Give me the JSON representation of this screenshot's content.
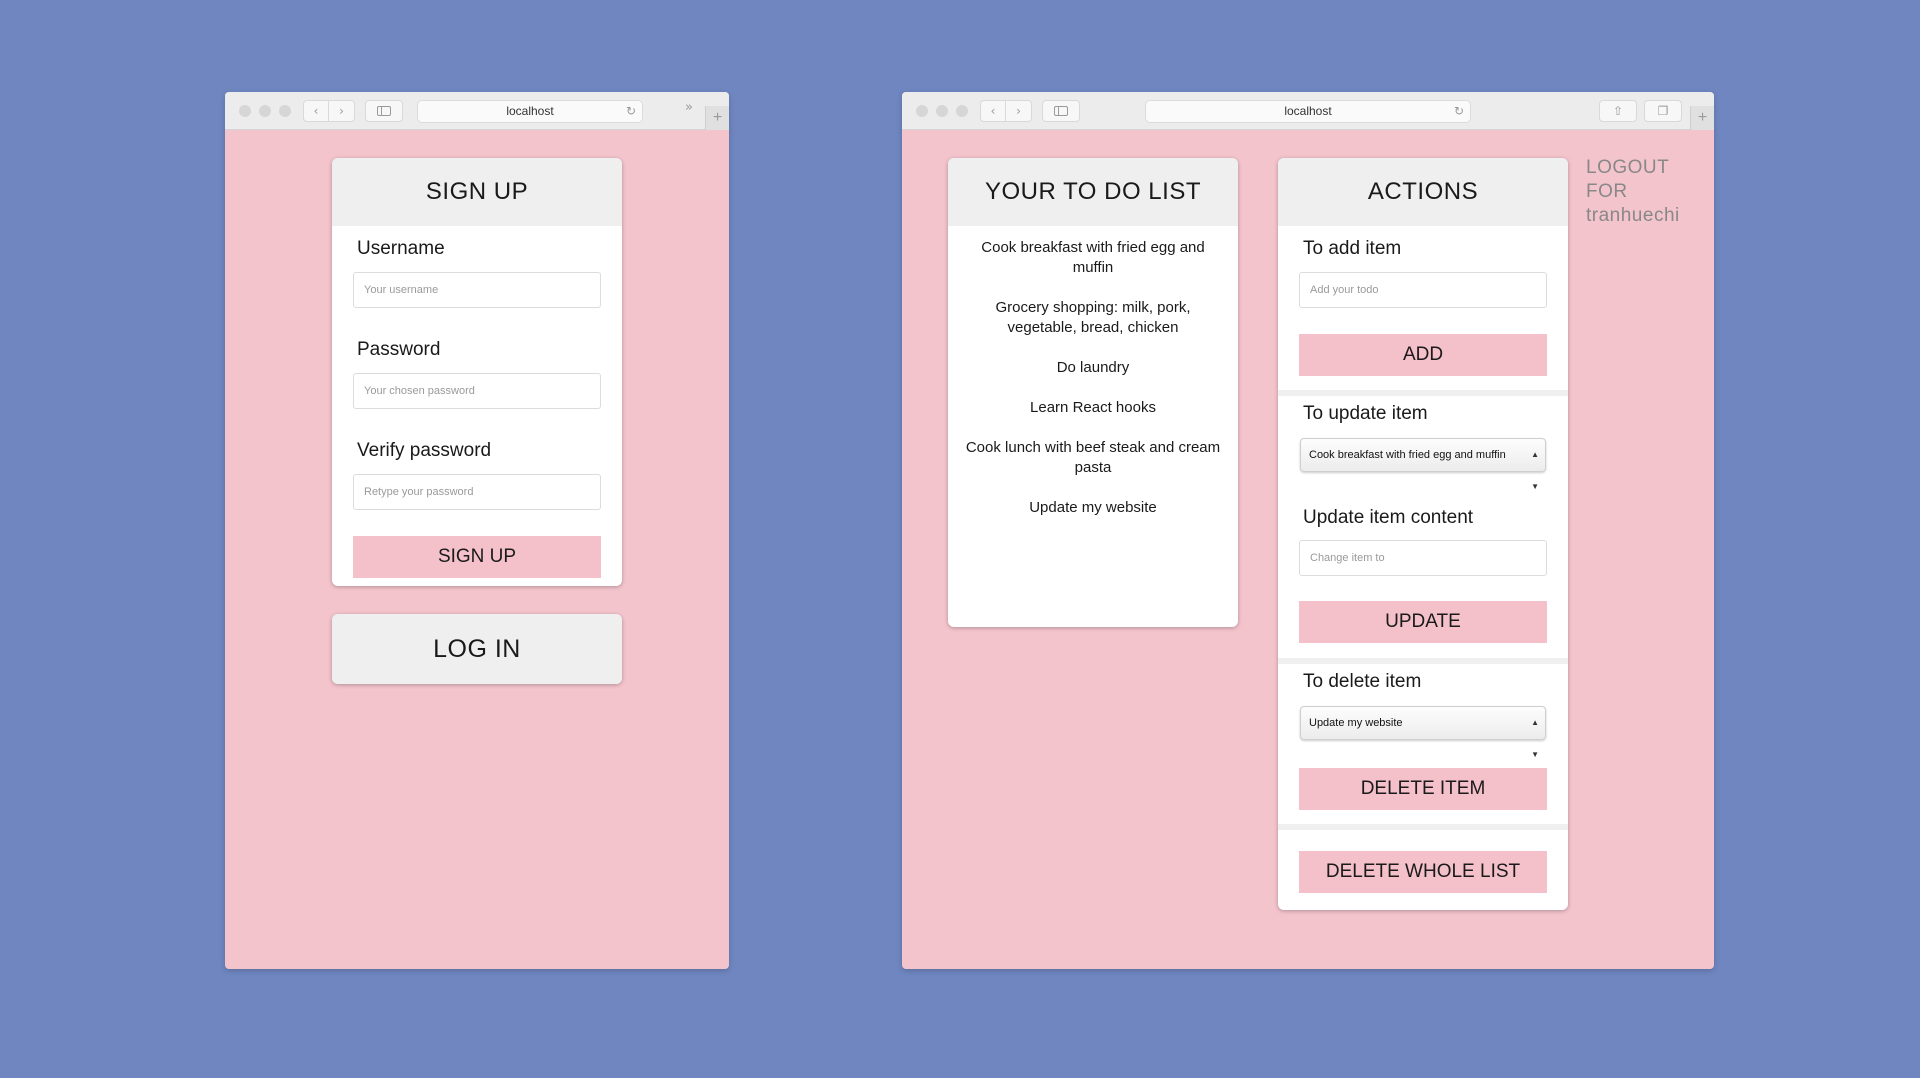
{
  "left_window": {
    "url": "localhost",
    "signup_card": {
      "title": "SIGN UP",
      "username_label": "Username",
      "username_placeholder": "Your username",
      "password_label": "Password",
      "password_placeholder": "Your chosen password",
      "verify_label": "Verify password",
      "verify_placeholder": "Retype your password",
      "submit_label": "SIGN UP"
    },
    "login_card": {
      "title": "LOG IN"
    }
  },
  "right_window": {
    "url": "localhost",
    "todo_card": {
      "title": "YOUR TO DO LIST",
      "items": [
        "Cook breakfast with fried egg and muffin",
        "Grocery shopping: milk, pork, vegetable, bread, chicken",
        "Do laundry",
        "Learn React hooks",
        "Cook lunch with beef steak and cream pasta",
        "Update my website"
      ]
    },
    "actions_card": {
      "title": "ACTIONS",
      "add_label": "To add item",
      "add_placeholder": "Add your todo",
      "add_button": "ADD",
      "update_label": "To update item",
      "update_selected": "Cook breakfast with fried egg and muffin",
      "update_content_label": "Update item content",
      "update_content_placeholder": "Change item to",
      "update_button": "UPDATE",
      "delete_label": "To delete item",
      "delete_selected": "Update my website",
      "delete_button": "DELETE ITEM",
      "delete_all_button": "DELETE WHOLE LIST"
    },
    "logout": {
      "line1": "LOGOUT",
      "line2": "FOR",
      "line3": "tranhuechi"
    }
  },
  "icons": {
    "back": "chevron-left-icon",
    "forward": "chevron-right-icon",
    "sidebar": "sidebar-icon",
    "reload": "reload-icon",
    "share": "share-icon",
    "tabs": "tabs-icon",
    "new_tab": "plus-icon",
    "overflow": "double-chevron-icon"
  },
  "colors": {
    "background": "#6f86c0",
    "page": "#f4c4cd",
    "button": "#f4c0ca",
    "card_header": "#efefef"
  }
}
